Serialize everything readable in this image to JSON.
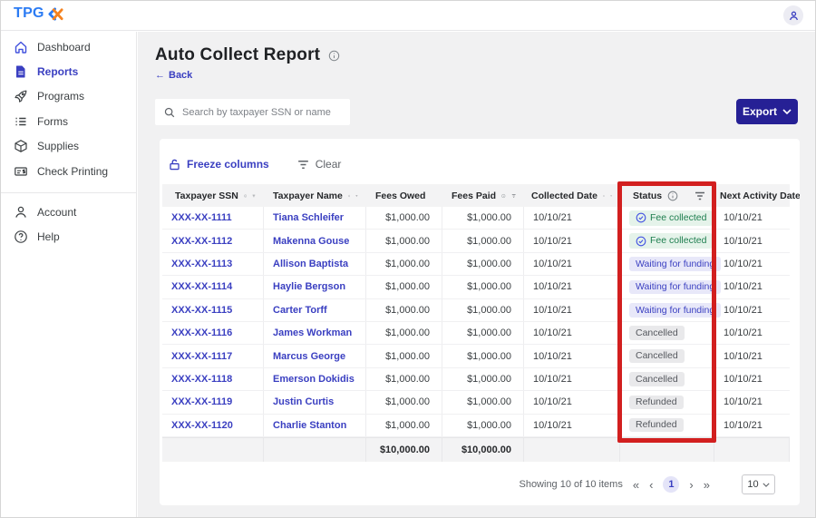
{
  "topbar": {
    "logo_text": "TPG",
    "logo_mark_blue": "#2b7bf3",
    "logo_mark_orange": "#f5821f"
  },
  "sidebar": {
    "items": [
      {
        "label": "Dashboard",
        "icon": "home-icon",
        "active": false
      },
      {
        "label": "Reports",
        "icon": "document-icon",
        "active": true
      },
      {
        "label": "Programs",
        "icon": "rocket-icon",
        "active": false
      },
      {
        "label": "Forms",
        "icon": "list-icon",
        "active": false
      },
      {
        "label": "Supplies",
        "icon": "package-icon",
        "active": false
      },
      {
        "label": "Check Printing",
        "icon": "check-printing-icon",
        "active": false
      },
      {
        "label": "Account",
        "icon": "person-icon",
        "active": false
      },
      {
        "label": "Help",
        "icon": "help-icon",
        "active": false
      }
    ]
  },
  "page": {
    "title": "Auto Collect Report",
    "back_label": "Back",
    "back_arrow": "←"
  },
  "search": {
    "placeholder": "Search by taxpayer SSN or name"
  },
  "toolbar": {
    "export_label": "Export"
  },
  "table_controls": {
    "freeze_label": "Freeze columns",
    "clear_label": "Clear"
  },
  "table": {
    "columns": [
      {
        "key": "ssn",
        "label": "Taxpayer SSN"
      },
      {
        "key": "name",
        "label": "Taxpayer Name"
      },
      {
        "key": "fees_owed",
        "label": "Fees Owed"
      },
      {
        "key": "fees_paid",
        "label": "Fees Paid"
      },
      {
        "key": "collected_date",
        "label": "Collected Date"
      },
      {
        "key": "status",
        "label": "Status"
      },
      {
        "key": "next_activity",
        "label": "Next Activity Date"
      }
    ],
    "rows": [
      {
        "ssn": "XXX-XX-1111",
        "name": "Tiana Schleifer",
        "fees_owed": "$1,000.00",
        "fees_paid": "$1,000.00",
        "collected_date": "10/10/21",
        "status": "Fee collected",
        "status_type": "success",
        "next_activity_date": "10/10/21"
      },
      {
        "ssn": "XXX-XX-1112",
        "name": "Makenna Gouse",
        "fees_owed": "$1,000.00",
        "fees_paid": "$1,000.00",
        "collected_date": "10/10/21",
        "status": "Fee collected",
        "status_type": "success",
        "next_activity_date": "10/10/21"
      },
      {
        "ssn": "XXX-XX-1113",
        "name": "Allison Baptista",
        "fees_owed": "$1,000.00",
        "fees_paid": "$1,000.00",
        "collected_date": "10/10/21",
        "status": "Waiting for funding",
        "status_type": "pending",
        "next_activity_date": "10/10/21"
      },
      {
        "ssn": "XXX-XX-1114",
        "name": "Haylie Bergson",
        "fees_owed": "$1,000.00",
        "fees_paid": "$1,000.00",
        "collected_date": "10/10/21",
        "status": "Waiting for funding",
        "status_type": "pending",
        "next_activity_date": "10/10/21"
      },
      {
        "ssn": "XXX-XX-1115",
        "name": "Carter Torff",
        "fees_owed": "$1,000.00",
        "fees_paid": "$1,000.00",
        "collected_date": "10/10/21",
        "status": "Waiting for funding",
        "status_type": "pending",
        "next_activity_date": "10/10/21"
      },
      {
        "ssn": "XXX-XX-1116",
        "name": "James Workman",
        "fees_owed": "$1,000.00",
        "fees_paid": "$1,000.00",
        "collected_date": "10/10/21",
        "status": "Cancelled",
        "status_type": "neutral",
        "next_activity_date": "10/10/21"
      },
      {
        "ssn": "XXX-XX-1117",
        "name": "Marcus George",
        "fees_owed": "$1,000.00",
        "fees_paid": "$1,000.00",
        "collected_date": "10/10/21",
        "status": "Cancelled",
        "status_type": "neutral",
        "next_activity_date": "10/10/21"
      },
      {
        "ssn": "XXX-XX-1118",
        "name": "Emerson Dokidis",
        "fees_owed": "$1,000.00",
        "fees_paid": "$1,000.00",
        "collected_date": "10/10/21",
        "status": "Cancelled",
        "status_type": "neutral",
        "next_activity_date": "10/10/21"
      },
      {
        "ssn": "XXX-XX-1119",
        "name": "Justin Curtis",
        "fees_owed": "$1,000.00",
        "fees_paid": "$1,000.00",
        "collected_date": "10/10/21",
        "status": "Refunded",
        "status_type": "neutral",
        "next_activity_date": "10/10/21"
      },
      {
        "ssn": "XXX-XX-1120",
        "name": "Charlie Stanton",
        "fees_owed": "$1,000.00",
        "fees_paid": "$1,000.00",
        "collected_date": "10/10/21",
        "status": "Refunded",
        "status_type": "neutral",
        "next_activity_date": "10/10/21"
      }
    ],
    "totals": {
      "fees_owed": "$10,000.00",
      "fees_paid": "$10,000.00"
    }
  },
  "pagination": {
    "summary": "Showing 10 of 10 items",
    "first": "«",
    "prev": "‹",
    "page": "1",
    "next": "›",
    "last": "»",
    "page_size": "10"
  },
  "colors": {
    "brand_indigo": "#3a3fc1",
    "export_button": "#262095",
    "highlight_red": "#d21f1f",
    "badge_success_bg": "#e5f3ea",
    "badge_success_text": "#1e7e4f",
    "badge_pending_bg": "#e8e8f9",
    "badge_pending_text": "#3a3fc1",
    "badge_neutral_bg": "#e9e9eb",
    "badge_neutral_text": "#55585e"
  }
}
